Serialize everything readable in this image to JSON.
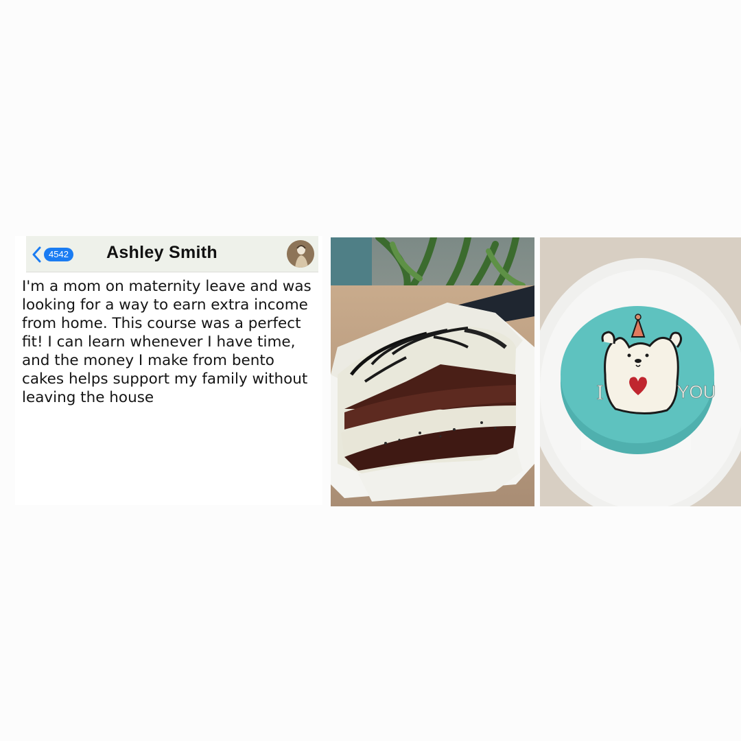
{
  "chat": {
    "back_count": "4542",
    "contact_name": "Ashley Smith",
    "message": "I'm a mom on maternity leave and was looking for a way to earn extra income from home. This course was a perfect fit! I can learn whenever I have time, and the money I make from bento cakes helps support my family without leaving the house"
  },
  "icons": {
    "back": "chevron-left-icon",
    "avatar": "profile-photo"
  },
  "photos": {
    "bear_cake": {
      "left_text": "I",
      "right_text": "YOU"
    }
  },
  "colors": {
    "accent": "#1a7cf2",
    "header_bg": "#eef1ea",
    "cake_teal": "#5ec2bf"
  }
}
